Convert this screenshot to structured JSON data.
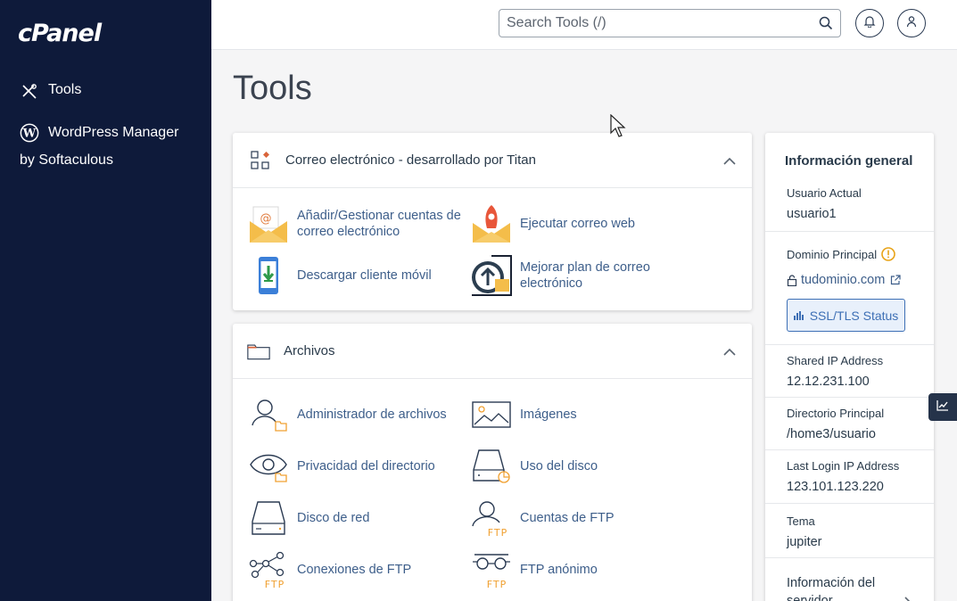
{
  "sidebar": {
    "logo": "cPanel",
    "items": [
      {
        "label": "Tools",
        "icon": "tools-icon"
      },
      {
        "label": "WordPress Manager",
        "sublabel": "by Softaculous",
        "icon": "wordpress-icon"
      }
    ]
  },
  "header": {
    "search_placeholder": "Search Tools (/)",
    "icons": [
      "search-icon",
      "bell-icon",
      "user-icon"
    ]
  },
  "page_title": "Tools",
  "sections": [
    {
      "title": "Correo electrónico - desarrollado por Titan",
      "icon": "email-apps-icon",
      "tools": [
        {
          "label": "Añadir/Gestionar cuentas de correo electrónico",
          "icon": "email-accounts-icon"
        },
        {
          "label": "Ejecutar correo web",
          "icon": "webmail-rocket-icon"
        },
        {
          "label": "Descargar cliente móvil",
          "icon": "mobile-download-icon"
        },
        {
          "label": "Mejorar plan de correo electrónico",
          "icon": "upgrade-plan-icon"
        }
      ]
    },
    {
      "title": "Archivos",
      "icon": "folder-icon",
      "tools": [
        {
          "label": "Administrador de archivos",
          "icon": "file-manager-icon"
        },
        {
          "label": "Imágenes",
          "icon": "images-icon"
        },
        {
          "label": "Privacidad del directorio",
          "icon": "directory-privacy-icon"
        },
        {
          "label": "Uso del disco",
          "icon": "disk-usage-icon"
        },
        {
          "label": "Disco de red",
          "icon": "network-disk-icon"
        },
        {
          "label": "Cuentas de FTP",
          "icon": "ftp-accounts-icon"
        },
        {
          "label": "Conexiones de FTP",
          "icon": "ftp-connections-icon"
        },
        {
          "label": "FTP anónimo",
          "icon": "anonymous-ftp-icon"
        }
      ]
    }
  ],
  "general_info": {
    "title": "Información general",
    "current_user_label": "Usuario Actual",
    "current_user": "usuario1",
    "primary_domain_label": "Dominio Principal",
    "primary_domain": "tudominio.com",
    "ssl_button": "SSL/TLS Status",
    "shared_ip_label": "Shared IP Address",
    "shared_ip": "12.12.231.100",
    "home_dir_label": "Directorio Principal",
    "home_dir": "/home3/usuario",
    "last_login_label": "Last Login IP Address",
    "last_login": "123.101.123.220",
    "theme_label": "Tema",
    "theme": "jupiter",
    "server_info": "Información del servidor"
  },
  "colors": {
    "sidebar_bg": "#0e1a3a",
    "link": "#3d5e8a",
    "accent_orange": "#f0a030",
    "warning": "#e8a317"
  }
}
